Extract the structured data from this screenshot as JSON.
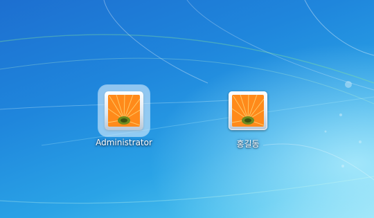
{
  "screen": {
    "name": "windows-7-logon-user-selection"
  },
  "users": [
    {
      "name": "Administrator",
      "picture": "orange-gerbera-flower",
      "selected": true
    },
    {
      "name": "홍길동",
      "picture": "orange-gerbera-flower",
      "selected": false
    }
  ],
  "colors": {
    "wallpaper_dark": "#1d6fd0",
    "wallpaper_light": "#8fe0f6",
    "petal": "#ff7a10",
    "flower_center": "#6e8a1e",
    "label_text": "#ffffff"
  }
}
